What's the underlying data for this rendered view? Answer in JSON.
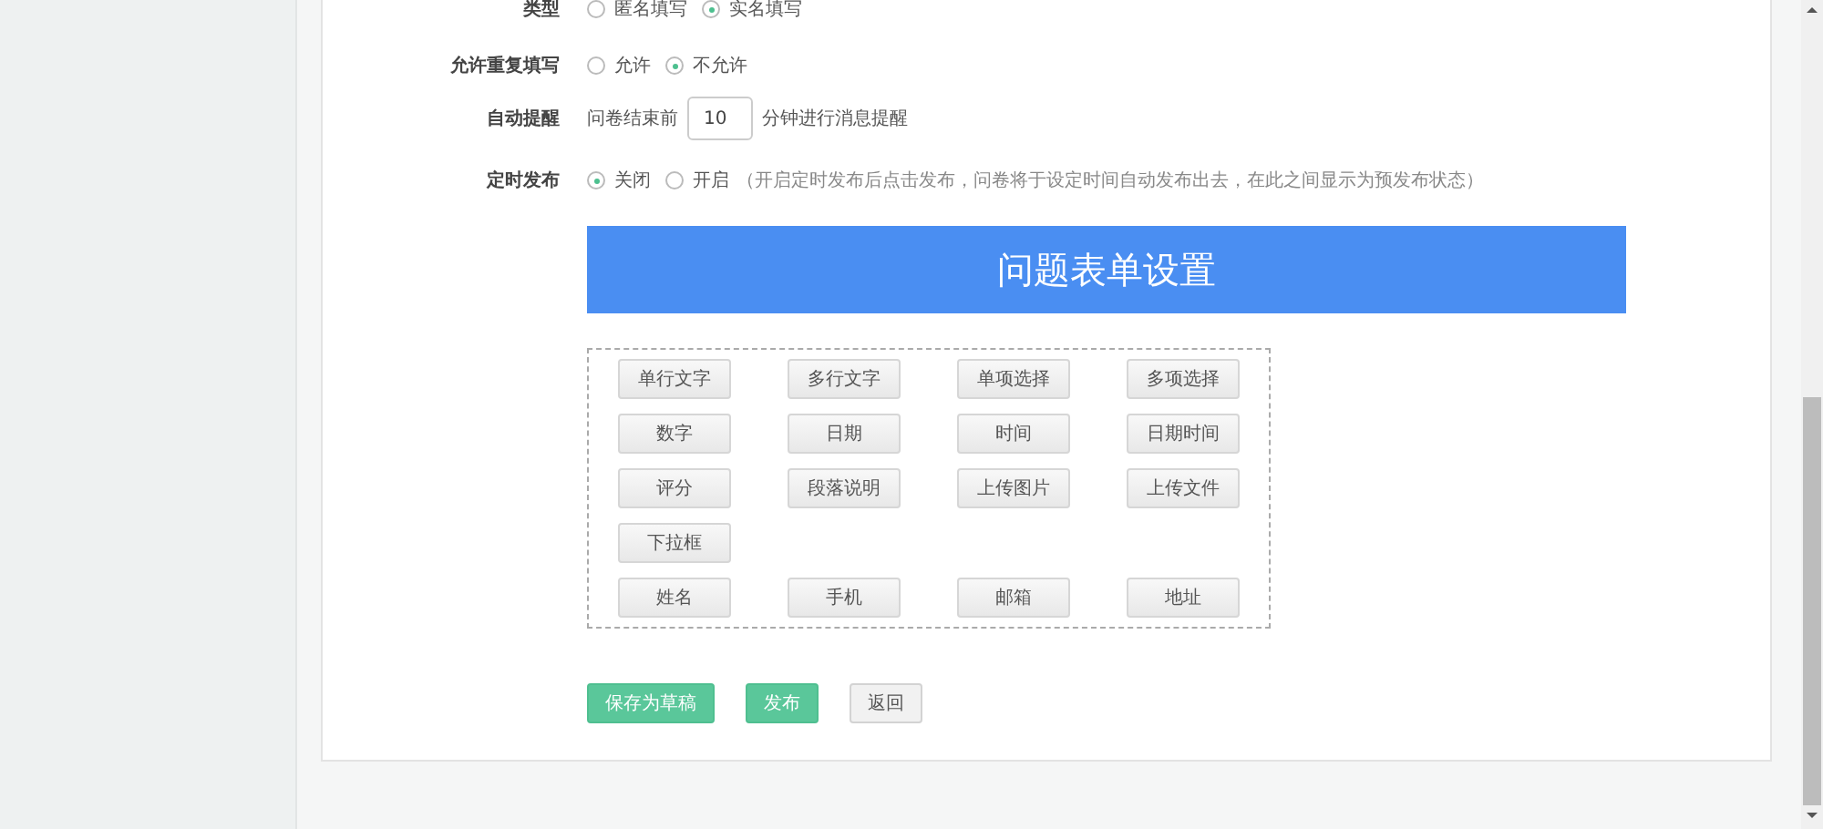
{
  "settings": [
    {
      "kind": "radio",
      "label": "类型",
      "options": [
        {
          "label": "匿名填写",
          "selected": false
        },
        {
          "label": "实名填写",
          "selected": true
        }
      ]
    },
    {
      "kind": "radio",
      "label": "允许重复填写",
      "options": [
        {
          "label": "允许",
          "selected": false
        },
        {
          "label": "不允许",
          "selected": true
        }
      ]
    },
    {
      "kind": "number",
      "label": "自动提醒",
      "prefix": "问卷结束前",
      "value": "10",
      "suffix": "分钟进行消息提醒"
    },
    {
      "kind": "radio",
      "label": "定时发布",
      "options": [
        {
          "label": "关闭",
          "selected": true
        },
        {
          "label": "开启",
          "selected": false
        }
      ],
      "note": "（开启定时发布后点击发布，问卷将于设定时间自动发布出去，在此之间显示为预发布状态）"
    }
  ],
  "section_title": "问题表单设置",
  "field_types": [
    [
      "单行文字",
      "多行文字",
      "单项选择",
      "多项选择"
    ],
    [
      "数字",
      "日期",
      "时间",
      "日期时间"
    ],
    [
      "评分",
      "段落说明",
      "上传图片",
      "上传文件"
    ],
    [
      "下拉框"
    ],
    [
      "姓名",
      "手机",
      "邮箱",
      "地址"
    ]
  ],
  "actions": [
    {
      "label": "保存为草稿",
      "kind": "primary"
    },
    {
      "label": "发布",
      "kind": "primary"
    },
    {
      "label": "返回",
      "kind": "default"
    }
  ]
}
